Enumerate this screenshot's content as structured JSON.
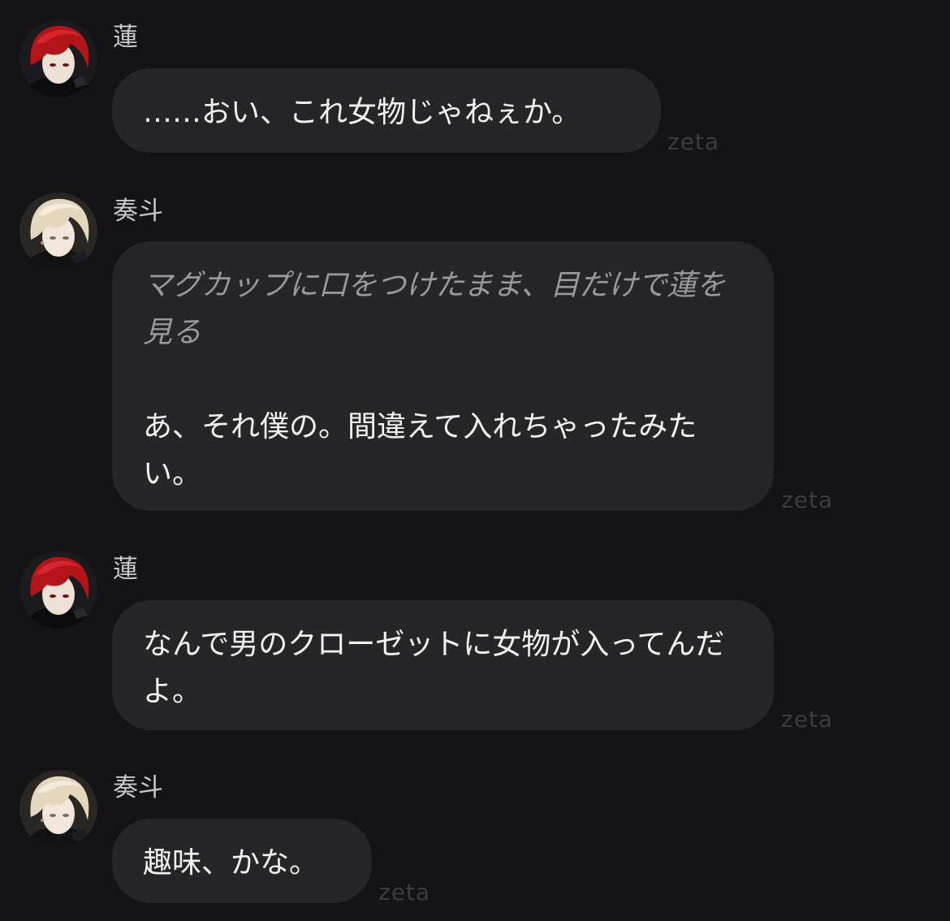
{
  "theme": {
    "background": "#141416",
    "bubble": "#262628",
    "text": "#f2f2f3",
    "narration_text": "#9a9a9e",
    "sender_text": "#c9c9cc",
    "watermark_text": "#3c3c40",
    "ren_hair": "#b3141a",
    "kanato_hair": "#e3d7bd"
  },
  "watermark": "zeta",
  "messages": [
    {
      "sender": "蓮",
      "avatar": "red-haired-character-avatar",
      "text": "……おい、これ女物じゃねぇか。"
    },
    {
      "sender": "奏斗",
      "avatar": "blond-character-avatar",
      "narration": "マグカップに口をつけたまま、目だけで蓮を見る",
      "text": "あ、それ僕の。間違えて入れちゃったみたい。"
    },
    {
      "sender": "蓮",
      "avatar": "red-haired-character-avatar",
      "text": "なんで男のクローゼットに女物が入ってんだよ。"
    },
    {
      "sender": "奏斗",
      "avatar": "blond-character-avatar",
      "text": "趣味、かな。"
    }
  ]
}
